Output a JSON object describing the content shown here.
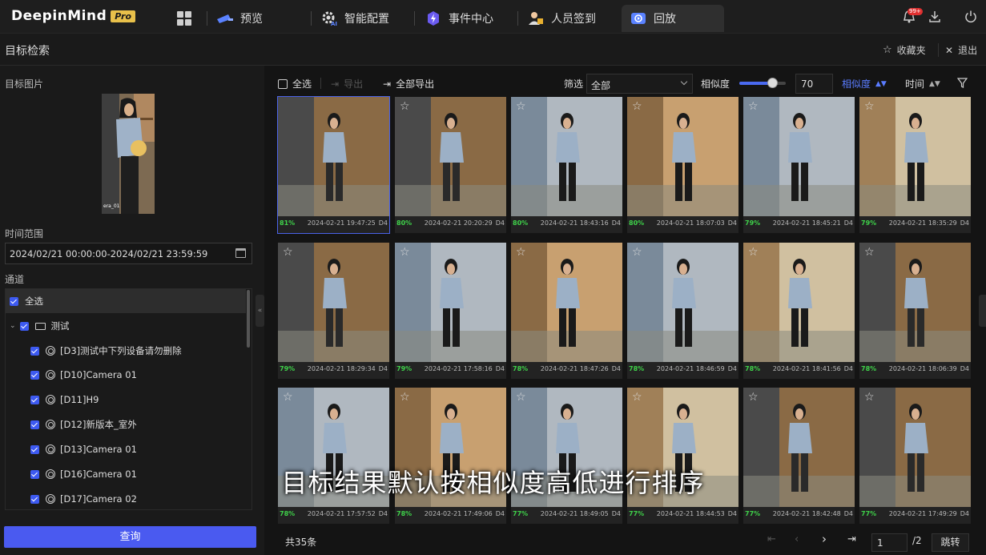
{
  "app": {
    "logo": "DeepinMind",
    "logo_badge": "Pro",
    "notification_count": "99+"
  },
  "nav": {
    "tabs": [
      {
        "label": "预览",
        "icon": "camera-icon"
      },
      {
        "label": "智能配置",
        "icon": "gear-ai-icon"
      },
      {
        "label": "事件中心",
        "icon": "lightning-icon"
      },
      {
        "label": "人员签到",
        "icon": "person-signin-icon"
      },
      {
        "label": "回放",
        "icon": "playback-icon",
        "active": true
      }
    ]
  },
  "page": {
    "title": "目标检索",
    "favorites": "收藏夹",
    "exit": "退出"
  },
  "left": {
    "target_label": "目标图片",
    "time_label": "时间范围",
    "time_value": "2024/02/21 00:00:00-2024/02/21 23:59:59",
    "channel_label": "通道",
    "select_all": "全选",
    "group": "测试",
    "channels": [
      "[D3]测试中下列设备请勿删除",
      "[D10]Camera 01",
      "[D11]H9",
      "[D12]新版本_室外",
      "[D13]Camera 01",
      "[D16]Camera 01",
      "[D17]Camera 02"
    ],
    "query": "查询"
  },
  "toolbar": {
    "select_all": "全选",
    "export": "导出",
    "export_all": "全部导出",
    "filter_label": "筛选",
    "filter_value": "全部",
    "similarity_label": "相似度",
    "similarity_value": "70",
    "similarity_fraction": 0.7,
    "sort_similarity": "相似度",
    "sort_time": "时间"
  },
  "results": [
    {
      "pct": "81%",
      "time": "2024-02-21 19:47:25",
      "ch": "D4"
    },
    {
      "pct": "80%",
      "time": "2024-02-21 20:20:29",
      "ch": "D4"
    },
    {
      "pct": "80%",
      "time": "2024-02-21 18:43:16",
      "ch": "D4"
    },
    {
      "pct": "80%",
      "time": "2024-02-21 18:07:03",
      "ch": "D4"
    },
    {
      "pct": "79%",
      "time": "2024-02-21 18:45:21",
      "ch": "D4"
    },
    {
      "pct": "79%",
      "time": "2024-02-21 18:35:29",
      "ch": "D4"
    },
    {
      "pct": "79%",
      "time": "2024-02-21 18:29:34",
      "ch": "D4"
    },
    {
      "pct": "79%",
      "time": "2024-02-21 17:58:16",
      "ch": "D4"
    },
    {
      "pct": "78%",
      "time": "2024-02-21 18:47:26",
      "ch": "D4"
    },
    {
      "pct": "78%",
      "time": "2024-02-21 18:46:59",
      "ch": "D4"
    },
    {
      "pct": "78%",
      "time": "2024-02-21 18:41:56",
      "ch": "D4"
    },
    {
      "pct": "78%",
      "time": "2024-02-21 18:06:39",
      "ch": "D4"
    },
    {
      "pct": "78%",
      "time": "2024-02-21 17:57:52",
      "ch": "D4"
    },
    {
      "pct": "78%",
      "time": "2024-02-21 17:49:06",
      "ch": "D4"
    },
    {
      "pct": "77%",
      "time": "2024-02-21 18:49:05",
      "ch": "D4"
    },
    {
      "pct": "77%",
      "time": "2024-02-21 18:44:53",
      "ch": "D4"
    },
    {
      "pct": "77%",
      "time": "2024-02-21 18:42:48",
      "ch": "D4"
    },
    {
      "pct": "77%",
      "time": "2024-02-21 17:49:29",
      "ch": "D4"
    }
  ],
  "caption": "目标结果默认按相似度高低进行排序",
  "pager": {
    "total": "共35条",
    "page": "1",
    "pages": "/2",
    "jump": "跳转"
  }
}
